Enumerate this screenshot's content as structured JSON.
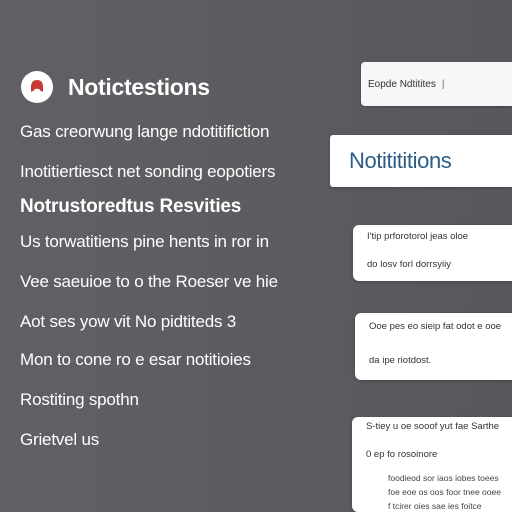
{
  "left": {
    "title": "Notictestions",
    "icon": "bell-icon",
    "lines": [
      {
        "text": "Gas creorwung lange ndotitifiction",
        "bold": false
      },
      {
        "text": "Inotitiertiesct net sonding eopotiers",
        "bold": false
      },
      {
        "text": "Notrustoredtus Resvities",
        "bold": true
      },
      {
        "text": "Us torwatitiens pine hents in ror in",
        "bold": false
      },
      {
        "text": "Vee saeuioe to o the Roeser ve hie",
        "bold": false
      },
      {
        "text": "Aot ses yow vit No pidtiteds 3",
        "bold": false
      },
      {
        "text": "Mon to cone ro e esar notitioies",
        "bold": false
      },
      {
        "text": "Rostiting spothn",
        "bold": false
      },
      {
        "text": "Grietvel us",
        "bold": false
      }
    ]
  },
  "right": {
    "top_pill": {
      "label": "Eopde Ndtitites",
      "separator": "|"
    },
    "header_card": {
      "label": "Notitititions"
    },
    "notifications": [
      {
        "line1": "I'tip prforotorol jeas oloe",
        "line2": "do losv forl dorrsyiiy"
      },
      {
        "line1": "Ooe pes eo sieip fat odot e ooe",
        "line2": "da ipe riotdost."
      },
      {
        "line1": "S-tiey u oe sooof yut fae Sarthe",
        "line2": "0 ep fo rosoinore",
        "line3": "foodieod sor iaos iobes toees",
        "line4": "foe eoe os oos foor tnee ooee",
        "line5": "f tcirer oies sae ies foitce"
      }
    ]
  },
  "colors": {
    "background": "#5b5d61",
    "accent_title": "#2b5d87",
    "card": "#ffffff",
    "bell_dot": "#d9534f"
  }
}
